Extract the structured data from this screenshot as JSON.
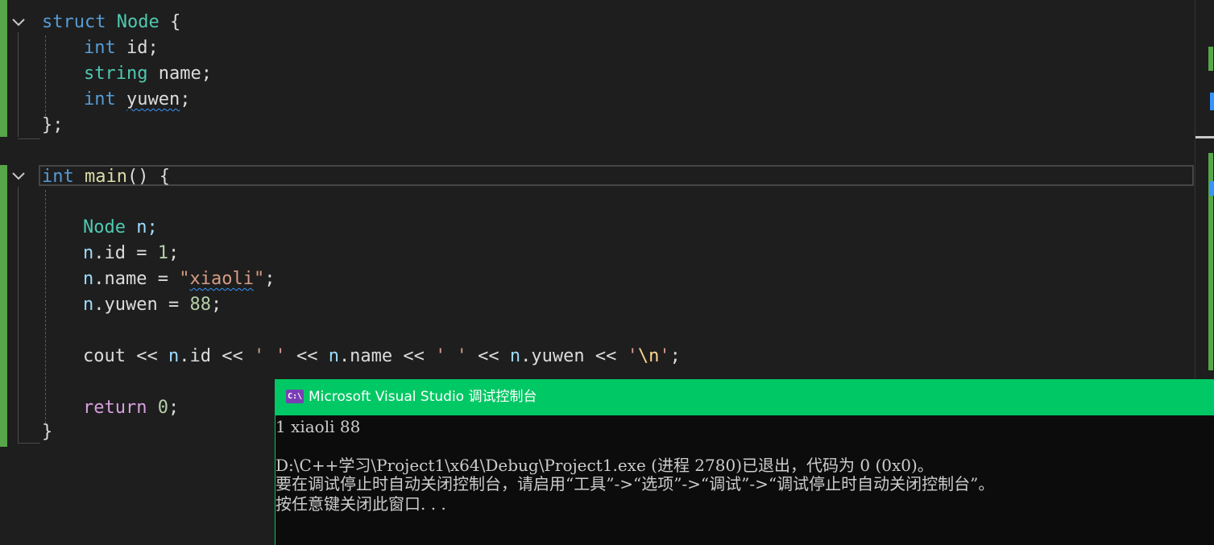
{
  "editor": {
    "lines": {
      "struct_kw": "struct",
      "struct_name": "Node",
      "open_brace": " {",
      "int1": "int",
      "id_field": " id;",
      "string_ty": "string",
      "name_field": " name;",
      "int2": "int",
      "yuwen_sp": " ",
      "yuwen_field": "yuwen",
      "semi": ";",
      "close_struct": "};",
      "main_int": "int",
      "main_sp": " ",
      "main_fn": "main",
      "main_rest": "() {",
      "node_ty": "Node",
      "node_var": " n;",
      "n1": "n",
      "id_assign": ".id = ",
      "one": "1",
      "semi1": ";",
      "n2": "n",
      "name_assign": ".name = ",
      "str_q1": "\"",
      "str_body": "xiaoli",
      "str_q2": "\"",
      "semi2": ";",
      "n3": "n",
      "yuwen_assign": ".yuwen = ",
      "eighty_eight": "88",
      "semi3": ";",
      "cout": "cout",
      "op1": " << ",
      "n4": "n",
      "dot_id": ".id",
      "op2": " << ",
      "sp_char1": "' '",
      "op3": " << ",
      "n5": "n",
      "dot_name": ".name",
      "op4": " << ",
      "sp_char2": "' '",
      "op5": " << ",
      "n6": "n",
      "dot_yuwen": ".yuwen",
      "op6": " << ",
      "nl_q1": "'",
      "nl_esc": "\\n",
      "nl_q2": "'",
      "semi4": ";",
      "return_kw": "return",
      "zero_sp": " ",
      "zero": "0",
      "semi5": ";",
      "close_main": "}"
    }
  },
  "console": {
    "icon": "C:\\",
    "title": "Microsoft Visual Studio 调试控制台",
    "output": "1 xiaoli 88",
    "exit_msg": "D:\\C++学习\\Project1\\x64\\Debug\\Project1.exe (进程 2780)已退出，代码为 0 (0x0)。",
    "hint_msg": "要在调试停止时自动关闭控制台，请启用“工具”->“选项”->“调试”->“调试停止时自动关闭控制台”。",
    "press_key": "按任意键关闭此窗口. . ."
  },
  "colors": {
    "editor_bg": "#1e1e1e",
    "change_bar": "#57a64a",
    "console_title_bg": "#00c864",
    "keyword": "#569cd6",
    "type": "#4ec9b0"
  }
}
